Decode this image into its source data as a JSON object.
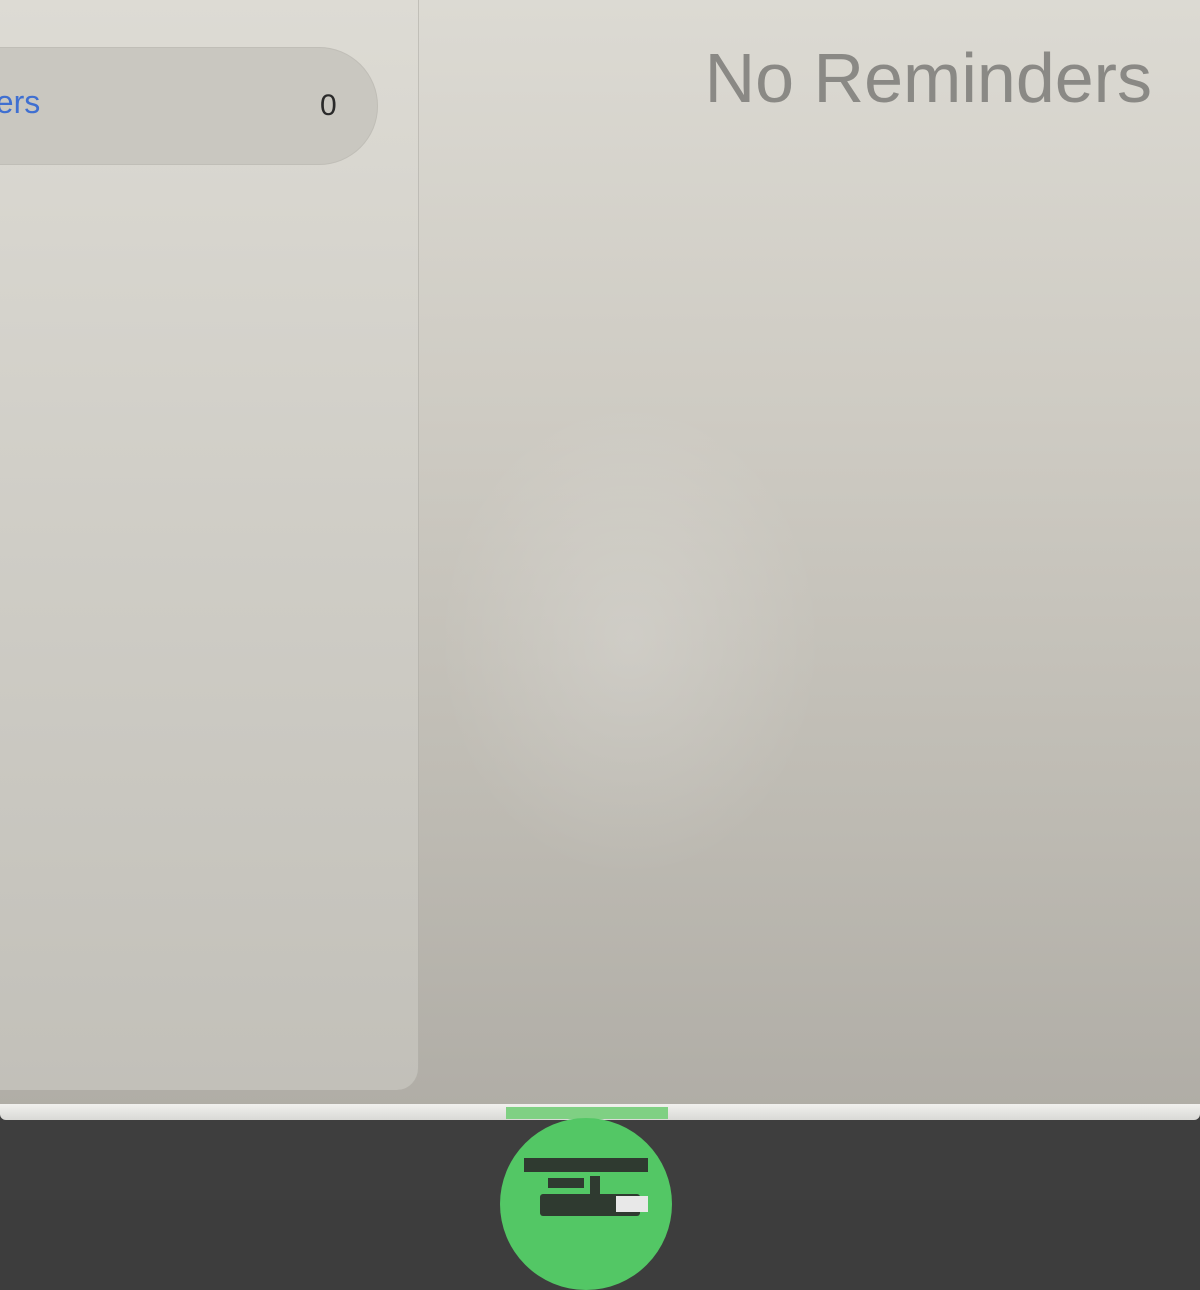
{
  "sidebar": {
    "list": {
      "label": "ders",
      "count": "0"
    }
  },
  "detail": {
    "empty_title": "No Reminders"
  },
  "colors": {
    "accent": "#3f6fd1",
    "sticker": "#53c765",
    "muted_text": "#8a8985"
  },
  "icons": {
    "sticker": "green-circle-sticker-icon"
  }
}
